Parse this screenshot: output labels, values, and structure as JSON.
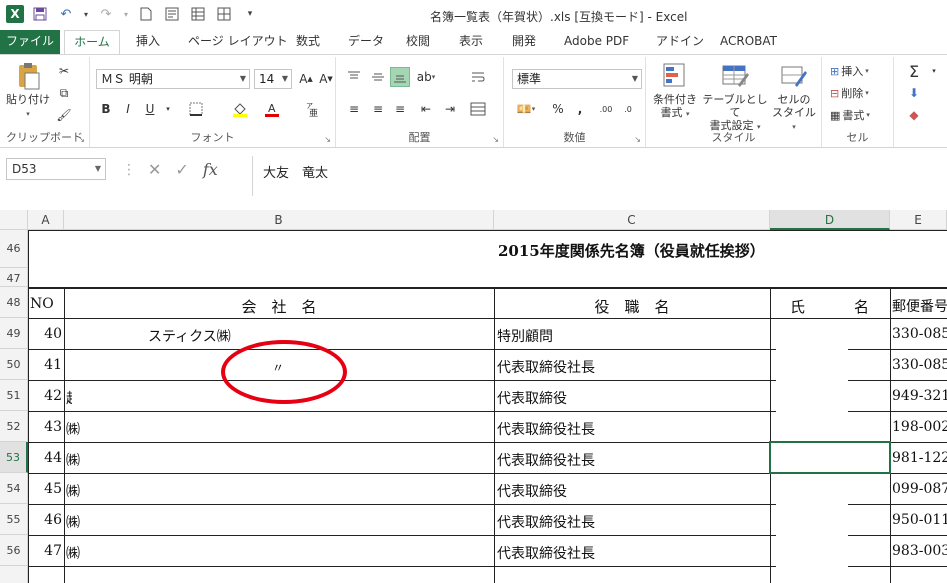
{
  "titlebar": {
    "title": "名簿一覧表（年賀状）.xls  [互換モード] - Excel",
    "logo": "X"
  },
  "tabs": [
    "ファイル",
    "ホーム",
    "挿入",
    "ページ レイアウト",
    "数式",
    "データ",
    "校閲",
    "表示",
    "開発",
    "Adobe PDF",
    "アドイン",
    "ACROBAT"
  ],
  "ribbon": {
    "clipboard": {
      "paste": "貼り付け",
      "label": "クリップボード"
    },
    "font": {
      "name": "ＭＳ 明朝",
      "size": "14",
      "label": "フォント",
      "bold": "B",
      "italic": "I",
      "underline": "U"
    },
    "alignment": {
      "label": "配置"
    },
    "number": {
      "format": "標準",
      "label": "数値"
    },
    "styles": {
      "conditional": "条件付き",
      "conditional2": "書式",
      "table": "テーブルとして",
      "table2": "書式設定",
      "cell": "セルの",
      "cell2": "スタイル",
      "label": "スタイル"
    },
    "cells": {
      "insert": "挿入",
      "delete": "削除",
      "format": "書式",
      "label": "セル"
    }
  },
  "formula_bar": {
    "name_box": "D53",
    "value": "大友　竜太"
  },
  "columns": [
    "A",
    "B",
    "C",
    "D",
    "E"
  ],
  "rows": [
    "46",
    "47",
    "48",
    "49",
    "50",
    "51",
    "52",
    "53",
    "54",
    "55",
    "56"
  ],
  "sheet": {
    "title": "2015年度関係先名簿（役員就任挨拶）",
    "headers": {
      "no": "NO",
      "company": "会　社　名",
      "position": "役　職　名",
      "name_left": "氏",
      "name_right": "名",
      "postal": "郵便番号"
    },
    "records": [
      {
        "no": "40",
        "company": "スティクス㈱",
        "position": "特別顧問",
        "postal": "330-085"
      },
      {
        "no": "41",
        "company": "〃",
        "position": "代表取締役社長",
        "postal": "330-085"
      },
      {
        "no": "42",
        "company": "越",
        "position": "代表取締役",
        "postal": "949-321"
      },
      {
        "no": "43",
        "company": "㈱",
        "position": "代表取締役社長",
        "postal": "198-002"
      },
      {
        "no": "44",
        "company": "㈱",
        "position": "代表取締役社長",
        "postal": "981-122"
      },
      {
        "no": "45",
        "company": "㈱",
        "position": "代表取締役",
        "postal": "099-087"
      },
      {
        "no": "46",
        "company": "㈱",
        "position": "代表取締役社長",
        "postal": "950-011"
      },
      {
        "no": "47",
        "company": "㈱",
        "position": "代表取締役社長",
        "postal": "983-003"
      }
    ]
  }
}
